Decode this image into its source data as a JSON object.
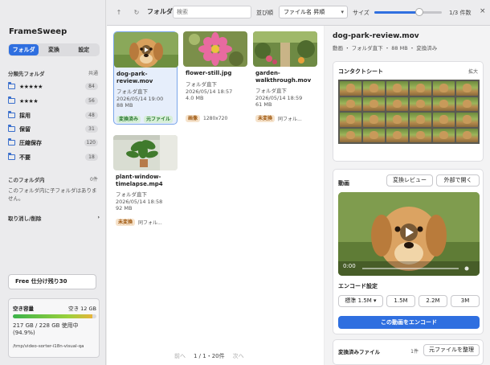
{
  "app": {
    "name": "FrameSweep"
  },
  "sidebar": {
    "tabs": [
      {
        "label": "フォルダ",
        "active": true
      },
      {
        "label": "変換",
        "active": false
      },
      {
        "label": "設定",
        "active": false
      }
    ],
    "sort_folders_header": "分類先フォルダ",
    "sort_folders_aux": "共通",
    "folders": [
      {
        "label": "★★★★★",
        "count": "84",
        "stars": true
      },
      {
        "label": "★★★★",
        "count": "56",
        "stars": true
      },
      {
        "label": "採用",
        "count": "48"
      },
      {
        "label": "保留",
        "count": "31"
      },
      {
        "label": "圧縮保存",
        "count": "120"
      },
      {
        "label": "不要",
        "count": "18"
      }
    ],
    "this_folder_header": "このフォルダ内",
    "this_folder_count": "0件",
    "this_folder_empty": "このフォルダ内に子フォルダはありません。",
    "undo_label": "取り消し/削除",
    "undo_chevron": "›",
    "free_label": "Free 仕分け残り30",
    "storage": {
      "label": "空き容量",
      "free": "空き 12 GB",
      "used_text": "217 GB / 228 GB 使用中",
      "percent_text": "(94.9%)",
      "used_fraction": 0.949,
      "path": "/tmp/video-sorter-i18n-visual-qa"
    }
  },
  "toolbar": {
    "back_icon": "↑",
    "refresh_icon": "↻",
    "folder_label": "フォルダ",
    "search_placeholder": "検索",
    "sort_label": "並び順",
    "sort_value": "ファイル名 昇順",
    "size_label": "サイズ",
    "size_slider_fraction": 0.68,
    "count": "1/3  件数",
    "close_icon": "×"
  },
  "files": [
    {
      "name": "dog-park-review.mov",
      "folder": "フォルダ直下",
      "date": "2026/05/14 19:00",
      "size": "88 MB",
      "tag1": "変換済み",
      "tag1_color": "green",
      "tag2": "元ファイル",
      "selected": true,
      "is_video": true
    },
    {
      "name": "flower-still.jpg",
      "folder": "フォルダ直下",
      "date": "2026/05/14 18:57",
      "size": "4.0 MB",
      "tag1": "画像",
      "tag1_color": "orange",
      "tag2": "1280x720"
    },
    {
      "name": "garden-walkthrough.mov",
      "folder": "フォルダ直下",
      "date": "2026/05/14 18:59",
      "size": "61 MB",
      "tag1": "未変換",
      "tag1_color": "orange",
      "tag2": "同フォル..."
    },
    {
      "name": "plant-window-timelapse.mp4",
      "folder": "フォルダ直下",
      "date": "2026/05/14 18:58",
      "size": "92 MB",
      "tag1": "未変換",
      "tag1_color": "orange",
      "tag2": "同フォル..."
    }
  ],
  "pager": {
    "prev": "前へ",
    "page": "1 / 1・20件",
    "next": "次へ"
  },
  "detail": {
    "filename": "dog-park-review.mov",
    "subtitle": "動画 ・ フォルダ直下 ・ 88 MB ・ 変換済み",
    "contact_sheet": {
      "title": "コンタクトシート",
      "expand": "拡大"
    },
    "video": {
      "title": "動画",
      "btn_review": "変換レビュー",
      "btn_external": "外部で開く",
      "time": "0:00"
    },
    "encode": {
      "label": "エンコード設定",
      "options": [
        "標準 1.5M",
        "1.5M",
        "2.2M",
        "3M"
      ],
      "button": "この動画をエンコード"
    },
    "converted": {
      "title": "変換済みファイル",
      "count": "1件",
      "button": "元ファイルを整理"
    }
  }
}
